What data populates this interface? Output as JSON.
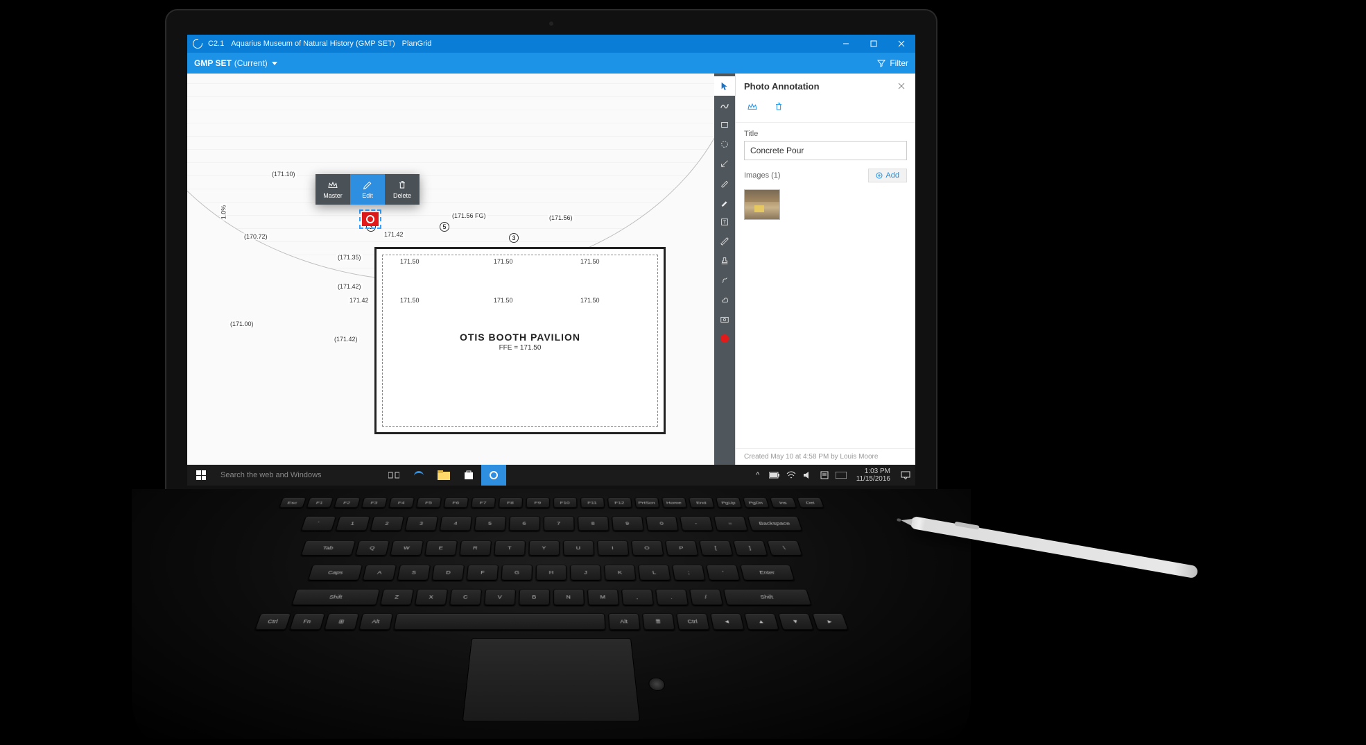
{
  "titlebar": {
    "doc_id": "C2.1",
    "project": "Aquarius Museum of Natural History (GMP SET)",
    "app": "PlanGrid"
  },
  "subheader": {
    "set_name": "GMP SET",
    "current_label": "(Current)",
    "filter_label": "Filter"
  },
  "ctx": {
    "master": "Master",
    "edit": "Edit",
    "delete": "Delete"
  },
  "blueprint": {
    "building_title": "OTIS BOOTH PAVILION",
    "building_sub": "FFE = 171.50",
    "elevations": [
      "(171.10)",
      "(170.72)",
      "(171.35)",
      "(171.42)",
      "(171.00)",
      "(171.56 FG)",
      "(171.56)",
      "171.42",
      "171.50",
      "171.50",
      "171.50",
      "171.50",
      "171.50",
      "171.50",
      "171.42",
      "(171.42)"
    ],
    "grid_circles": [
      "3",
      "5",
      "3"
    ],
    "vertical_label": "1.0%"
  },
  "panel": {
    "heading": "Photo Annotation",
    "title_label": "Title",
    "title_value": "Concrete Pour",
    "images_label": "Images (1)",
    "add_label": "Add",
    "footer": "Created May 10 at 4:58 PM by Louis Moore"
  },
  "taskbar": {
    "search_placeholder": "Search the web and Windows",
    "time": "1:03 PM",
    "date": "11/15/2016"
  },
  "keyboard": {
    "fn_row": [
      "Esc",
      "F1",
      "F2",
      "F3",
      "F4",
      "F5",
      "F6",
      "F7",
      "F8",
      "F9",
      "F10",
      "F11",
      "F12",
      "PrtScn",
      "Home",
      "End",
      "PgUp",
      "PgDn",
      "Ins",
      "Del"
    ],
    "num_row": [
      "`",
      "1",
      "2",
      "3",
      "4",
      "5",
      "6",
      "7",
      "8",
      "9",
      "0",
      "-",
      "=",
      "Backspace"
    ],
    "q_row": [
      "Tab",
      "Q",
      "W",
      "E",
      "R",
      "T",
      "Y",
      "U",
      "I",
      "O",
      "P",
      "[",
      "]",
      "\\"
    ],
    "a_row": [
      "Caps",
      "A",
      "S",
      "D",
      "F",
      "G",
      "H",
      "J",
      "K",
      "L",
      ";",
      "'",
      "Enter"
    ],
    "z_row": [
      "Shift",
      "Z",
      "X",
      "C",
      "V",
      "B",
      "N",
      "M",
      ",",
      ".",
      "/",
      "Shift"
    ],
    "bottom": [
      "Ctrl",
      "Fn",
      "",
      "Alt",
      "",
      "Alt",
      "",
      "Ctrl"
    ]
  }
}
